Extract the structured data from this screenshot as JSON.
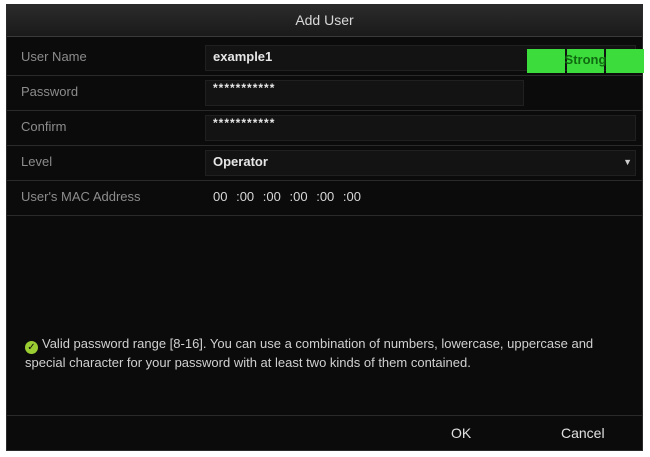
{
  "dialog": {
    "title": "Add User"
  },
  "form": {
    "username_label": "User Name",
    "username_value": "example1",
    "password_label": "Password",
    "password_value": "***********",
    "password_strength": "Strong",
    "confirm_label": "Confirm",
    "confirm_value": "***********",
    "level_label": "Level",
    "level_value": "Operator",
    "mac_label": "User's MAC Address",
    "mac_octets": [
      "00",
      ":00",
      ":00",
      ":00",
      ":00",
      ":00"
    ]
  },
  "hint": {
    "text": "Valid password range [8-16]. You can use a combination of numbers, lowercase, uppercase and special character for your password with at least two kinds of them contained."
  },
  "footer": {
    "ok_label": "OK",
    "cancel_label": "Cancel"
  },
  "colors": {
    "strength_fill": "#3ddc3d",
    "check_icon": "#9acd32"
  }
}
